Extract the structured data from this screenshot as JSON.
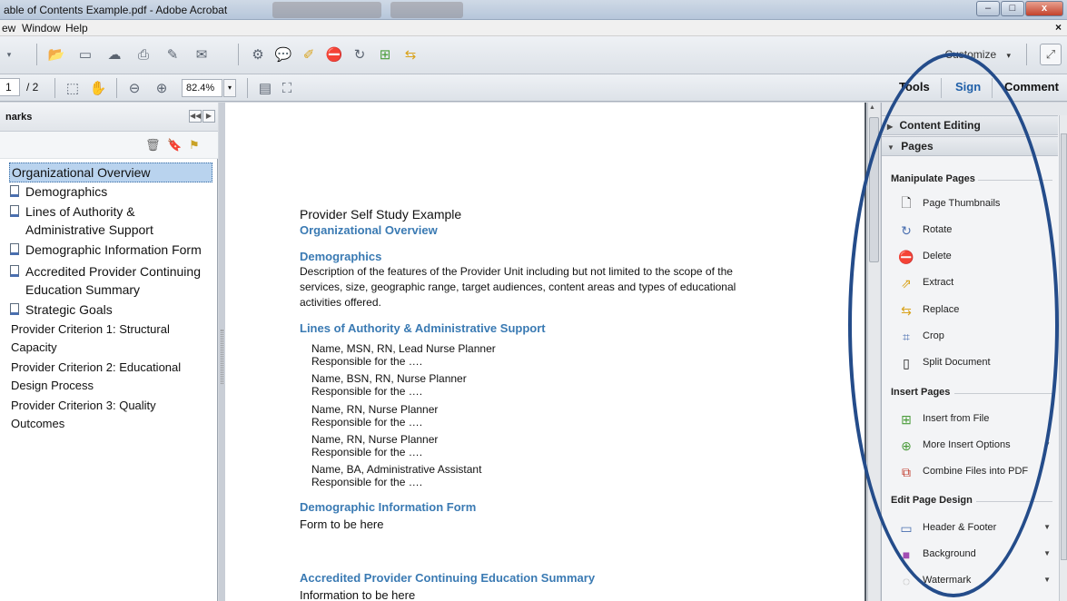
{
  "window": {
    "title": "able of Contents Example.pdf - Adobe Acrobat",
    "controls": [
      "–",
      "□",
      "x"
    ]
  },
  "menu": {
    "items": [
      "ew",
      "Window",
      "Help"
    ],
    "close": "×"
  },
  "toolbar": {
    "customize_label": "Customize",
    "customize_arrow": "▾",
    "expand_icon": "expand-icon"
  },
  "nav": {
    "page_current": "1",
    "page_total": "/ 2",
    "zoom": "82.4%",
    "zoom_arrow": "▾"
  },
  "right_tabs": {
    "tools": "Tools",
    "sign": "Sign",
    "comment": "Comment"
  },
  "colors": {
    "accent": "#1f5fa8",
    "heading_blue": "#3a7ab3",
    "annotation": "#244c8a",
    "selected_bookmark": "#b9d3ee"
  },
  "bookmarks_panel": {
    "title": "narks",
    "items": [
      {
        "label": "Organizational Overview",
        "selected": true,
        "icon": false
      },
      {
        "label": "Demographics",
        "icon": true
      },
      {
        "label": "Lines of Authority &",
        "line2": "Administrative Support",
        "icon": true
      },
      {
        "label": "Demographic Information Form",
        "icon": true
      },
      {
        "label": "Accredited Provider Continuing",
        "line2": "Education Summary",
        "icon": true
      },
      {
        "label": "Strategic Goals",
        "icon": true
      },
      {
        "label": "Provider Criterion 1: Structural",
        "line2": "Capacity",
        "icon": false
      },
      {
        "label": "Provider Criterion 2: Educational",
        "line2": "Design Process",
        "icon": false
      },
      {
        "label": "Provider Criterion 3: Quality",
        "line2": "Outcomes",
        "icon": false
      }
    ]
  },
  "document": {
    "title": "Provider Self Study Example",
    "section_org": "Organizational Overview",
    "section_demo": "Demographics",
    "demo_text_1": "Description of the features of the Provider Unit including but not limited to the scope of the",
    "demo_text_2": "services, size, geographic range, target audiences, content areas and types of educational",
    "demo_text_3": "activities offered.",
    "section_lines": "Lines of Authority & Administrative Support",
    "staff": [
      {
        "name": "Name, MSN, RN, Lead Nurse Planner",
        "resp": "Responsible for the …."
      },
      {
        "name": "Name, BSN, RN, Nurse Planner",
        "resp": "Responsible for the …."
      },
      {
        "name": "Name, RN, Nurse Planner",
        "resp": "Responsible for the …."
      },
      {
        "name": "Name, RN, Nurse Planner",
        "resp": "Responsible for the …."
      },
      {
        "name": "Name, BA, Administrative Assistant",
        "resp": "Responsible for the …."
      }
    ],
    "section_form": "Demographic Information Form",
    "form_text": "Form to be here",
    "section_acc": "Accredited Provider Continuing Education Summary",
    "acc_text": "Information to be here"
  },
  "tools_panel": {
    "content_editing": "Content Editing",
    "pages": "Pages",
    "manipulate_pages": "Manipulate Pages",
    "manipulate_items": [
      {
        "label": "Page Thumbnails",
        "icon": "page-thumbnails-icon"
      },
      {
        "label": "Rotate",
        "icon": "rotate-icon"
      },
      {
        "label": "Delete",
        "icon": "delete-icon"
      },
      {
        "label": "Extract",
        "icon": "extract-icon"
      },
      {
        "label": "Replace",
        "icon": "replace-icon"
      },
      {
        "label": "Crop",
        "icon": "crop-icon"
      },
      {
        "label": "Split Document",
        "icon": "split-document-icon"
      }
    ],
    "insert_pages": "Insert Pages",
    "insert_items": [
      {
        "label": "Insert from File",
        "icon": "insert-from-file-icon"
      },
      {
        "label": "More Insert Options",
        "icon": "more-insert-options-icon",
        "dropdown": true
      },
      {
        "label": "Combine Files into PDF",
        "icon": "combine-files-icon"
      }
    ],
    "edit_page_design": "Edit Page Design",
    "design_items": [
      {
        "label": "Header & Footer",
        "icon": "header-footer-icon",
        "dropdown": true
      },
      {
        "label": "Background",
        "icon": "background-icon",
        "dropdown": true
      },
      {
        "label": "Watermark",
        "icon": "watermark-icon",
        "dropdown": true
      }
    ]
  }
}
